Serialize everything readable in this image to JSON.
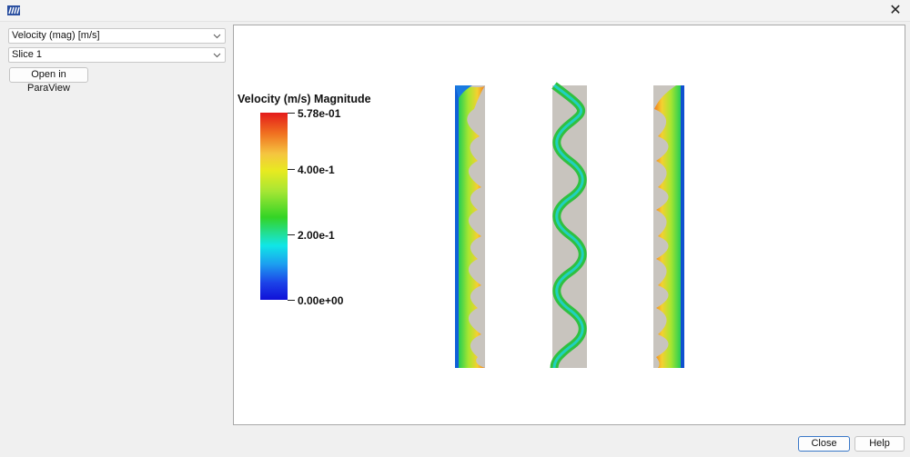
{
  "window": {
    "app_icon": "app-logo-icon",
    "close_icon": "close-icon"
  },
  "controls": {
    "field_select": {
      "value": "Velocity (mag) [m/s]"
    },
    "slice_select": {
      "value": "Slice 1"
    },
    "open_paraview_label": "Open in ParaView"
  },
  "legend": {
    "title": "Velocity (m/s) Magnitude",
    "ticks": [
      "5.78e-01",
      "4.00e-1",
      "2.00e-1",
      "0.00e+00"
    ],
    "max_value": 0.578,
    "tick_values": [
      0.578,
      0.4,
      0.2,
      0.0
    ]
  },
  "colors": {
    "channel_wall": "#c8c4be",
    "accent_blue": "#2a5fb0"
  },
  "footer": {
    "close_label": "Close",
    "help_label": "Help"
  }
}
